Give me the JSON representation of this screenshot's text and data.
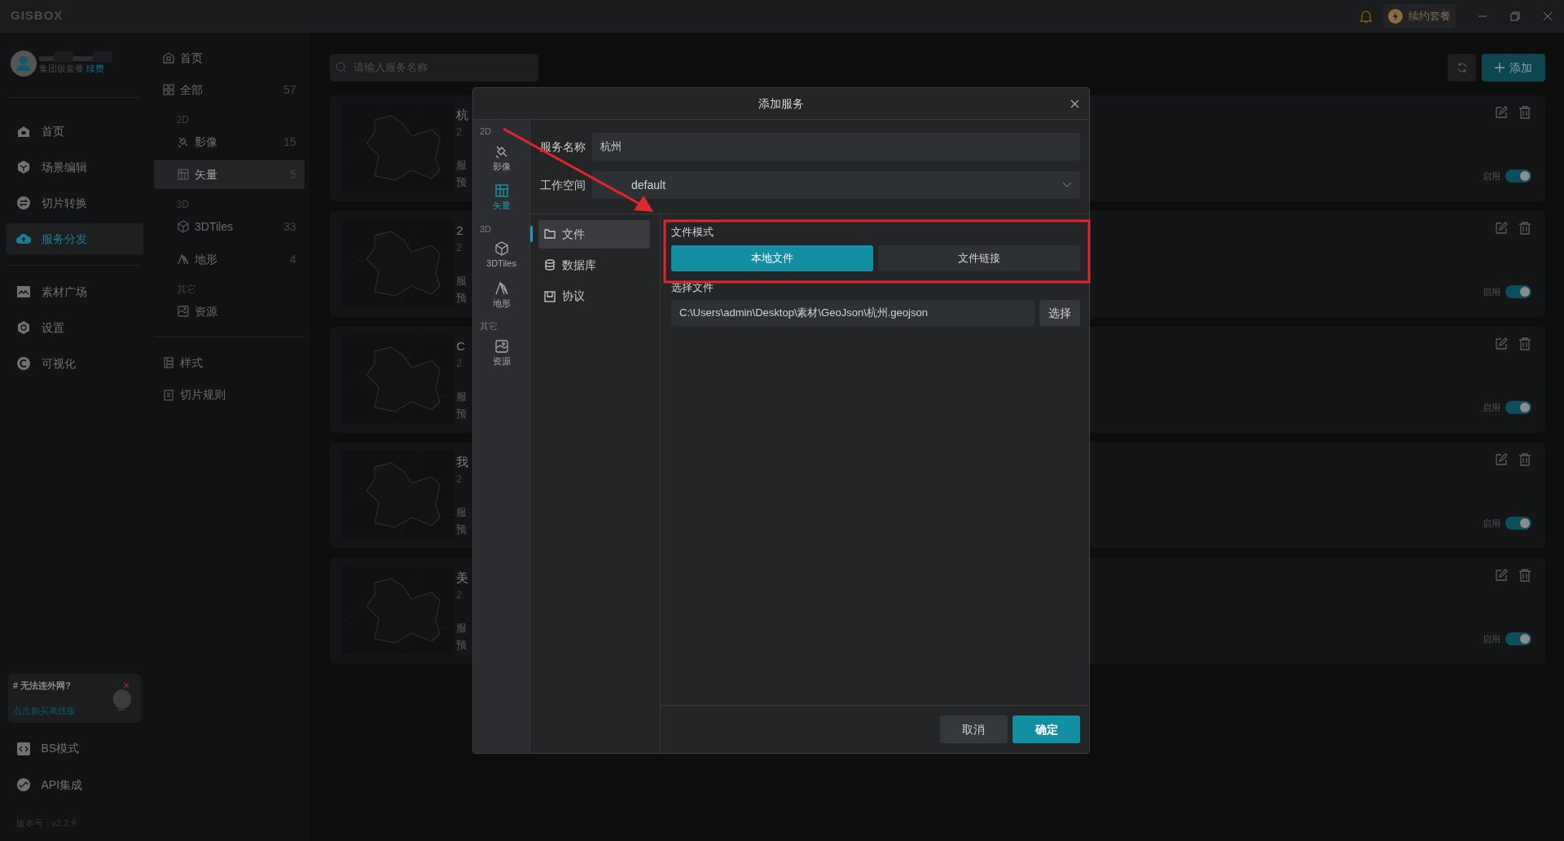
{
  "app": {
    "logo": "GISBOX"
  },
  "topbar": {
    "renew_label": "续约套餐"
  },
  "user": {
    "plan": "集团版套餐",
    "renew_link": "续费"
  },
  "nav_main": [
    {
      "label": "首页",
      "selected": false
    },
    {
      "label": "场景编辑",
      "selected": false
    },
    {
      "label": "切片转换",
      "selected": false
    },
    {
      "label": "服务分发",
      "selected": true
    }
  ],
  "nav_more": [
    {
      "label": "素材广场",
      "selected": false
    },
    {
      "label": "设置",
      "selected": false
    },
    {
      "label": "可视化",
      "selected": false
    }
  ],
  "promo": {
    "title": "# 无法连外网?",
    "link": "点击购买离线版"
  },
  "nav_bottom": [
    {
      "label": "BS模式"
    },
    {
      "label": "API集成"
    }
  ],
  "version": "版本号：v2.2.9",
  "categories": {
    "home": "首页",
    "all": {
      "label": "全部",
      "count": "57"
    },
    "groups": [
      {
        "heading": "2D",
        "items": [
          {
            "label": "影像",
            "count": "15",
            "selected": false
          },
          {
            "label": "矢量",
            "count": "5",
            "selected": true
          }
        ]
      },
      {
        "heading": "3D",
        "items": [
          {
            "label": "3DTiles",
            "count": "33",
            "selected": false
          },
          {
            "label": "地形",
            "count": "4",
            "selected": false
          }
        ]
      },
      {
        "heading": "其它",
        "items": [
          {
            "label": "资源",
            "selected": false
          }
        ]
      }
    ],
    "extra": [
      "样式",
      "切片规则"
    ]
  },
  "search": {
    "placeholder": "请输入服务名称"
  },
  "add_button": "添加",
  "cards": [
    {
      "title": "杭",
      "date": "2",
      "line_1": "服",
      "line_2": "预",
      "toggle_label": "启用",
      "enabled": true
    },
    {
      "title": "2",
      "date": "2",
      "line_1": "服",
      "line_2": "预",
      "toggle_label": "启用",
      "enabled": true
    },
    {
      "title": "C",
      "date": "2",
      "line_1": "服",
      "line_2": "预",
      "toggle_label": "启用",
      "enabled": true
    },
    {
      "title": "我",
      "date": "2",
      "line_1": "服",
      "line_2": "预",
      "toggle_label": "启用",
      "enabled": true
    },
    {
      "title": "美",
      "date": "2",
      "line_1": "服",
      "line_2": "预",
      "toggle_label": "启用",
      "enabled": true
    }
  ],
  "dialog": {
    "title": "添加服务",
    "rail": [
      {
        "heading": "2D",
        "items": [
          {
            "label": "影像",
            "selected": false
          },
          {
            "label": "矢量",
            "selected": true
          }
        ]
      },
      {
        "heading": "3D",
        "items": [
          {
            "label": "3DTiles",
            "selected": false
          },
          {
            "label": "地形",
            "selected": false
          }
        ]
      },
      {
        "heading": "其它",
        "items": [
          {
            "label": "资源",
            "selected": false
          }
        ]
      }
    ],
    "name_label": "服务名称",
    "name_value": "杭州",
    "workspace_label": "工作空间",
    "workspace_value": "default",
    "sources": [
      {
        "label": "文件",
        "selected": true
      },
      {
        "label": "数据库",
        "selected": false
      },
      {
        "label": "协议",
        "selected": false
      }
    ],
    "file_mode_label": "文件模式",
    "file_modes": [
      {
        "label": "本地文件",
        "selected": true
      },
      {
        "label": "文件链接",
        "selected": false
      }
    ],
    "file_label": "选择文件",
    "file_path": "C:\\Users\\admin\\Desktop\\素材\\GeoJson\\杭州.geojson",
    "browse_button": "选择",
    "cancel_button": "取消",
    "ok_button": "确定"
  }
}
